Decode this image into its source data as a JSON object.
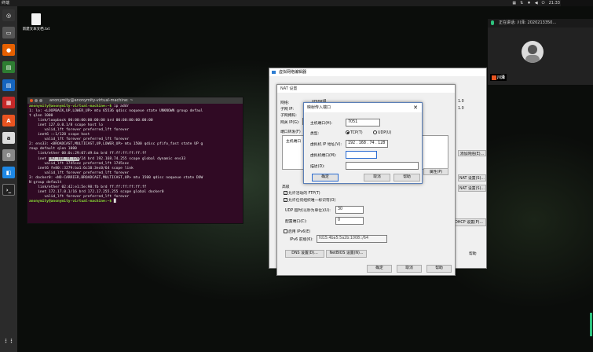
{
  "topbar": {
    "title": "终端",
    "clock": "21:33",
    "tray": [
      "▦",
      "⇅",
      "♦",
      "◀",
      "⏻"
    ]
  },
  "desktop": {
    "file_label": "新建文本文档.txt"
  },
  "terminal": {
    "title": "anonymity@anonymity-virtual-machine: ~",
    "lines": [
      [
        "g",
        "anonymity@anonymity-virtual-machine:~$ ",
        "ip addr"
      ],
      [
        "",
        "1: lo: <LOOPBACK,UP,LOWER_UP> mtu 65536 qdisc noqueue state UNKNOWN group defaul",
        ""
      ],
      [
        "",
        "t qlen 1000",
        ""
      ],
      [
        "",
        "    link/loopback 00:00:00:00:00:00 brd 00:00:00:00:00:00",
        ""
      ],
      [
        "",
        "    inet 127.0.0.1/8 scope host lo",
        ""
      ],
      [
        "",
        "       valid_lft forever preferred_lft forever",
        ""
      ],
      [
        "",
        "    inet6 ::1/128 scope host",
        ""
      ],
      [
        "",
        "       valid_lft forever preferred_lft forever",
        ""
      ],
      [
        "",
        "2: ens33: <BROADCAST,MULTICAST,UP,LOWER_UP> mtu 1500 qdisc pfifo_fast state UP g",
        ""
      ],
      [
        "",
        "roup default qlen 1000",
        ""
      ],
      [
        "",
        "    link/ether 00:0c:29:07:d9:ba brd ff:ff:ff:ff:ff:ff",
        ""
      ],
      [
        "h",
        "    inet ",
        "192.168.74.128",
        "/24 brd 192.168.74.255 scope global dynamic ens33"
      ],
      [
        "",
        "       valid_lft 1745sec preferred_lft 1745sec",
        ""
      ],
      [
        "",
        "    inet6 fe80::3279:ba1:6c10:3ec0/64 scope link",
        ""
      ],
      [
        "",
        "       valid_lft forever preferred_lft forever",
        ""
      ],
      [
        "",
        "3: docker0: <NO-CARRIER,BROADCAST,MULTICAST,UP> mtu 1500 qdisc noqueue state DOW",
        ""
      ],
      [
        "",
        "N group default",
        ""
      ],
      [
        "",
        "    link/ether 02:42:e1:5e:98:fb brd ff:ff:ff:ff:ff:ff",
        ""
      ],
      [
        "",
        "    inet 172.17.0.1/16 brd 172.17.255.255 scope global docker0",
        ""
      ],
      [
        "",
        "       valid_lft forever preferred_lft forever",
        ""
      ],
      [
        "g",
        "anonymity@anonymity-virtual-machine:~$ ",
        ""
      ]
    ]
  },
  "vmnet": {
    "title": "虚拟网络编辑器",
    "side_a": "1.0",
    "side_b": "1.0",
    "btn_add": "添加网络(E)...",
    "btn_nat": "NAT 设置(S)...",
    "btn_dhcp": "DHCP 设置(P)...",
    "btn_help": "帮助"
  },
  "nat": {
    "title": "NAT 设置",
    "network_label": "网络:",
    "network_value": "vmnet8",
    "subnet_ip_label": "子网 IP:",
    "subnet_ip_value": "19",
    "subnet_mask_label": "子网掩码:",
    "subnet_mask_value": "25",
    "gateway_label": "网关 IP(G):",
    "gateway_value": "1",
    "port_fwd_label": "端口转发(F)",
    "host_port_col": "主机端口",
    "props_btn": "属性(P)",
    "advanced_label": "高级",
    "allow_ftp": "允许活动的 FTP(T)",
    "allow_oui": "允许任何组织唯一标识符(O)",
    "udp_timeout_label": "UDP 超时(以秒为单位)(U):",
    "udp_timeout_value": "30",
    "config_port_label": "配置端口(C):",
    "config_port_value": "0",
    "enable_ipv6": "启用 IPv6(E)",
    "ipv6_prefix_label": "IPv6 前缀(6):",
    "ipv6_prefix_value": "fd15:4ba5:5a2b:1008::/64",
    "dns_btn": "DNS 设置(D)...",
    "netbios_btn": "NetBIOS 设置(N)...",
    "ok": "确定",
    "cancel": "取消",
    "help": "帮助"
  },
  "pmap": {
    "title": "映射传入端口",
    "close": "✕",
    "host_port_label": "主机端口(H):",
    "host_port_value": "7051",
    "type_label": "类型:",
    "tcp_label": "TCP(T)",
    "udp_label": "UDP(U)",
    "vm_ip_label": "虚拟机 IP 地址(V):",
    "vm_ip_value": "192 . 168 . 74 . 128",
    "vm_port_label": "虚拟机端口(M):",
    "vm_port_value": "",
    "desc_label": "描述(D):",
    "desc_value": "",
    "ok": "确定",
    "cancel": "取消",
    "help": "帮助"
  },
  "meeting": {
    "speaking": "正在讲话: 川泽: 2020213350...",
    "name": "川泽"
  },
  "colors": {
    "terminal_bg": "#300a24",
    "prompt": "#8ae234",
    "dock": "#2b2b2b",
    "accent": "#e95420"
  }
}
